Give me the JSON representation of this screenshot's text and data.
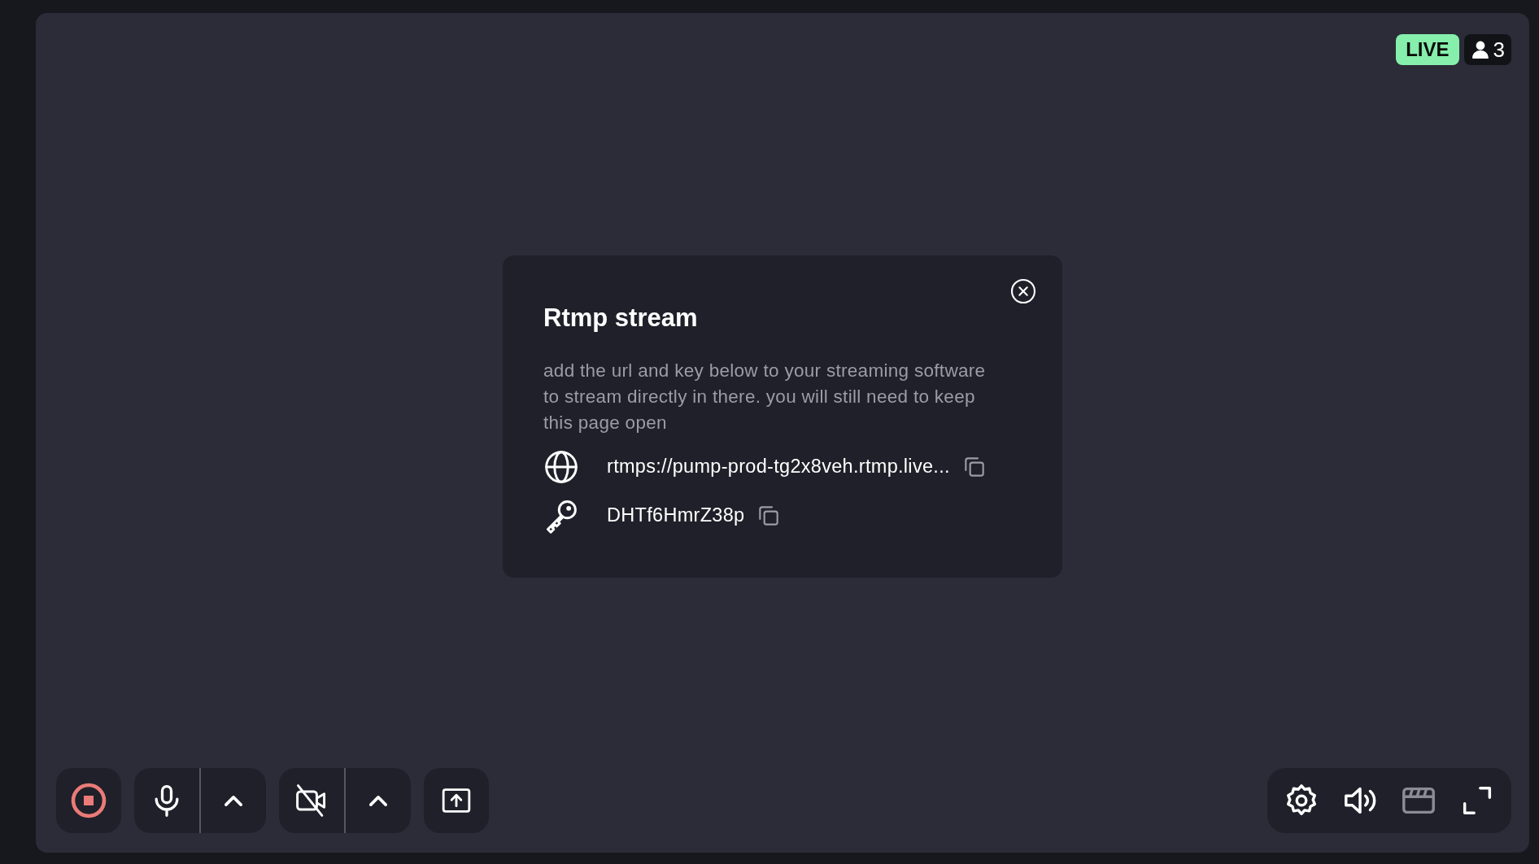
{
  "badges": {
    "live": "LIVE",
    "viewers": "3"
  },
  "dialog": {
    "title": "Rtmp stream",
    "description": "add the url and key below to your streaming software to stream directly in there. you will still need to keep this page open",
    "fields": [
      {
        "kind": "url",
        "value": "rtmps://pump-prod-tg2x8veh.rtmp.live..."
      },
      {
        "kind": "key",
        "value": "DHTf6HmrZ38p"
      }
    ]
  },
  "left_controls": [
    {
      "kind": "record",
      "on": true
    },
    {
      "kind": "microphone",
      "on": true,
      "menu": true
    },
    {
      "kind": "camera",
      "on": false,
      "menu": true
    },
    {
      "kind": "share"
    }
  ],
  "right_controls": [
    {
      "kind": "settings",
      "disabled": false
    },
    {
      "kind": "volume",
      "disabled": false
    },
    {
      "kind": "scenes",
      "disabled": true
    },
    {
      "kind": "fullscreen",
      "disabled": false
    }
  ]
}
